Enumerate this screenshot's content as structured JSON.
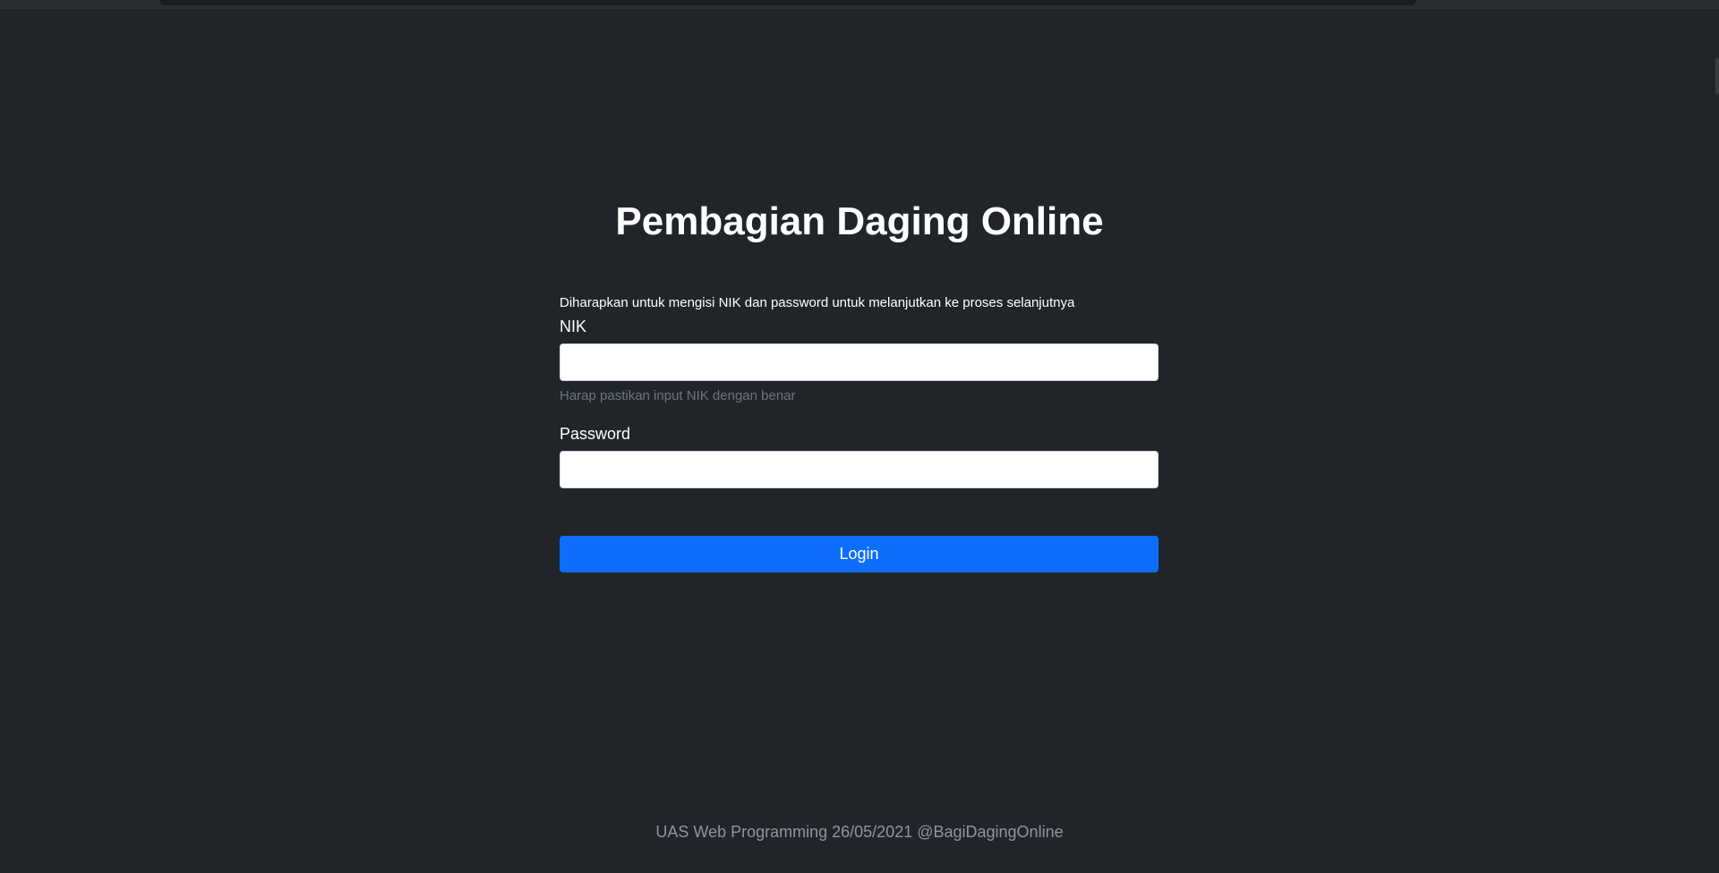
{
  "page": {
    "title": "Pembagian Daging Online"
  },
  "form": {
    "instruction": "Diharapkan untuk mengisi NIK dan password untuk melanjutkan ke proses selanjutnya",
    "nik": {
      "label": "NIK",
      "value": "",
      "help": "Harap pastikan input NIK dengan benar"
    },
    "password": {
      "label": "Password",
      "value": ""
    },
    "login_label": "Login"
  },
  "footer": {
    "text": "UAS Web Programming 26/05/2021 @BagiDagingOnline"
  },
  "colors": {
    "background": "#212529",
    "primary": "#0d6efd",
    "muted": "#6c757d"
  }
}
